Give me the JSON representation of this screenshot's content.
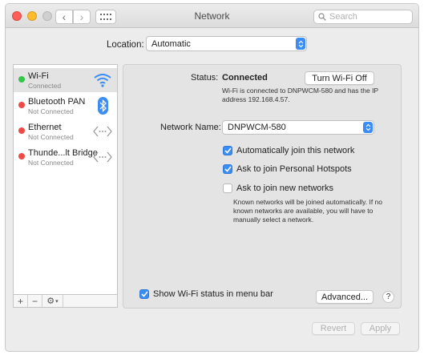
{
  "window": {
    "title": "Network",
    "search_placeholder": "Search"
  },
  "location": {
    "label": "Location:",
    "value": "Automatic"
  },
  "services": [
    {
      "name": "Wi-Fi",
      "status": "Connected",
      "dot": "green",
      "icon": "wifi-icon"
    },
    {
      "name": "Bluetooth PAN",
      "status": "Not Connected",
      "dot": "red",
      "icon": "bluetooth-icon"
    },
    {
      "name": "Ethernet",
      "status": "Not Connected",
      "dot": "red",
      "icon": "ethernet-arrows-icon"
    },
    {
      "name": "Thunde...lt Bridge",
      "status": "Not Connected",
      "dot": "red",
      "icon": "ethernet-arrows-icon"
    }
  ],
  "sidebar_tools": {
    "add": "+",
    "remove": "−"
  },
  "detail": {
    "status_label": "Status:",
    "status_value": "Connected",
    "turn_off_button": "Turn Wi-Fi Off",
    "status_description": "Wi-Fi is connected to DNPWCM-580 and has the IP address 192.168.4.57.",
    "network_name_label": "Network Name:",
    "network_name_value": "DNPWCM-580",
    "auto_join_label": "Automatically join this network",
    "auto_join_checked": true,
    "ask_hotspots_label": "Ask to join Personal Hotspots",
    "ask_hotspots_checked": true,
    "ask_new_label": "Ask to join new networks",
    "ask_new_checked": false,
    "ask_new_description": "Known networks will be joined automatically. If no known networks are available, you will have to manually select a network.",
    "show_status_label": "Show Wi-Fi status in menu bar",
    "show_status_checked": true,
    "advanced_button": "Advanced...",
    "help_button": "?"
  },
  "footer": {
    "revert_button": "Revert",
    "apply_button": "Apply"
  },
  "colors": {
    "accent": "#3b8cf5",
    "connected": "#32c748",
    "disconnected": "#ec4a43"
  }
}
